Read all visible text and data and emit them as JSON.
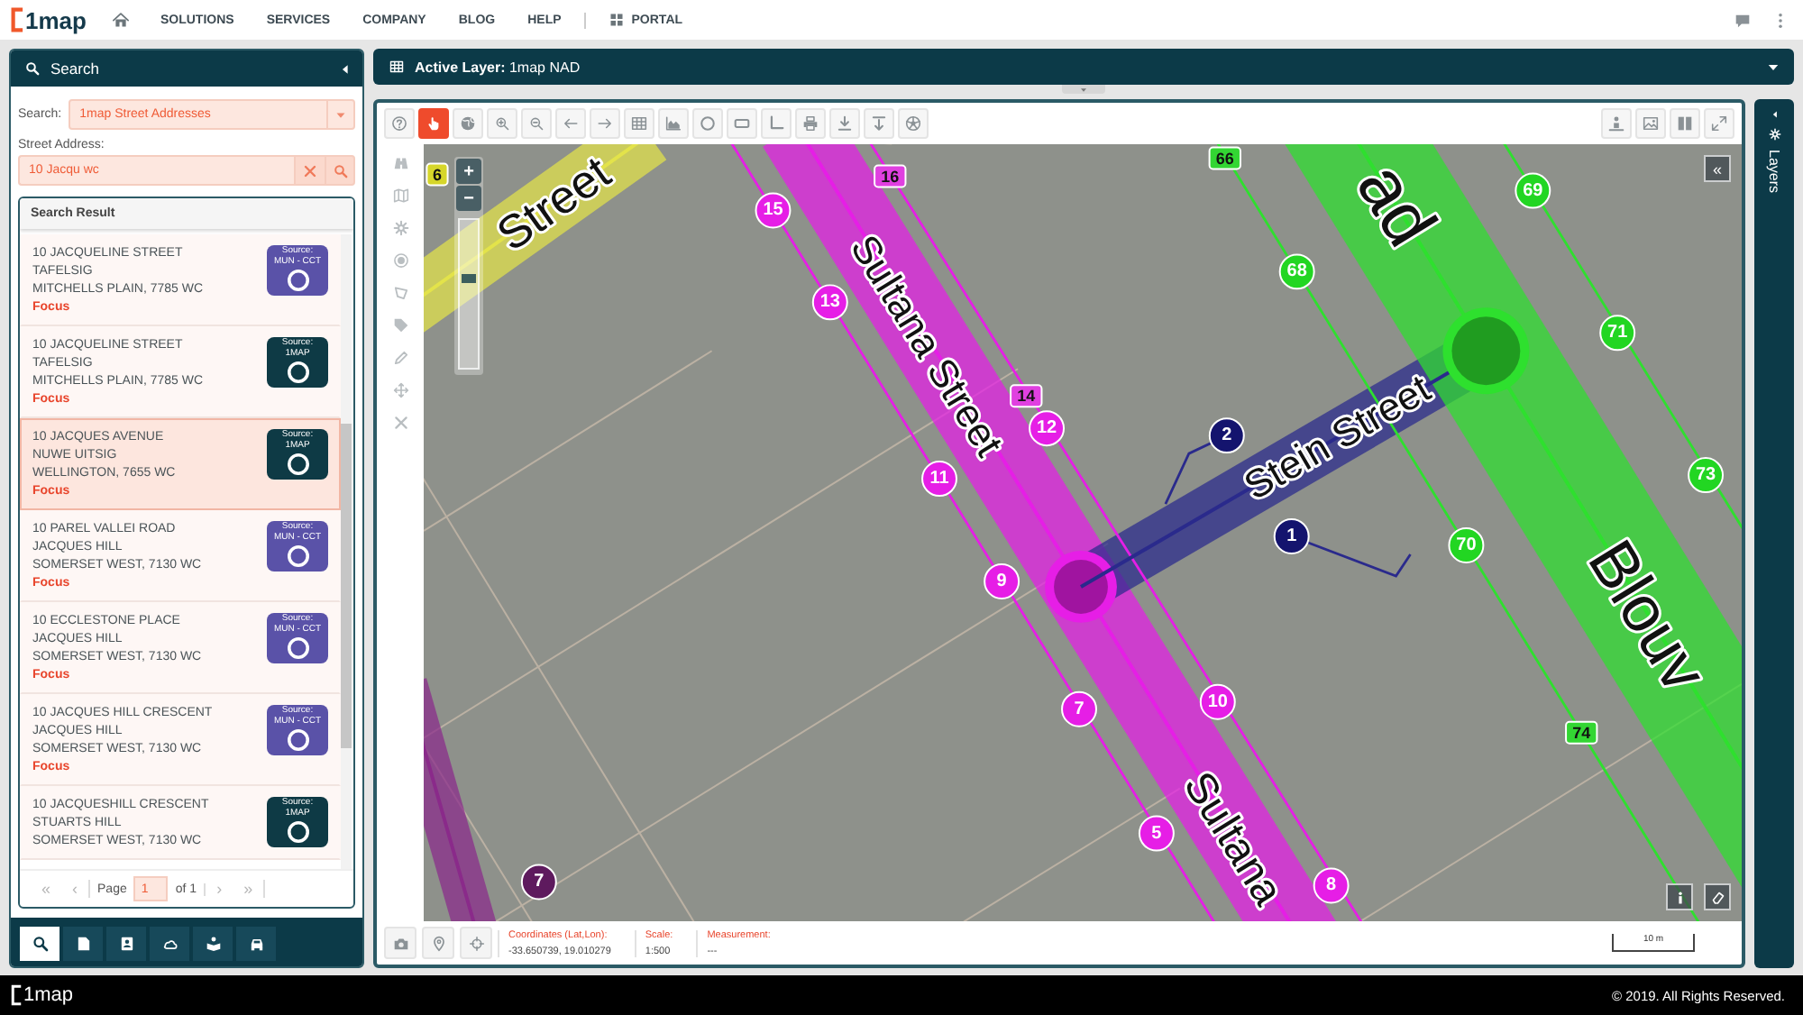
{
  "nav": {
    "logo": "1map",
    "links": [
      "SOLUTIONS",
      "SERVICES",
      "COMPANY",
      "BLOG",
      "HELP"
    ],
    "portal": "PORTAL"
  },
  "search_panel": {
    "title": "Search",
    "search_label": "Search:",
    "search_value": "1map Street Addresses",
    "address_label": "Street Address:",
    "address_value": "10 Jacqu wc",
    "results_title": "Search Result",
    "results": [
      {
        "lines": [
          "10 JACQUELINE STREET",
          "TAFELSIG",
          "MITCHELLS PLAIN, 7785 WC"
        ],
        "focus": "Focus",
        "selected": false,
        "source": {
          "label": "Source:",
          "name": "MUN - CCT",
          "color": "#5a52a8"
        }
      },
      {
        "lines": [
          "10 JACQUELINE STREET",
          "TAFELSIG",
          "MITCHELLS PLAIN, 7785 WC"
        ],
        "focus": "Focus",
        "selected": false,
        "source": {
          "label": "Source:",
          "name": "1MAP",
          "color": "#0e3a45"
        }
      },
      {
        "lines": [
          "10 JACQUES AVENUE",
          "NUWE UITSIG",
          "WELLINGTON, 7655 WC"
        ],
        "focus": "Focus",
        "selected": true,
        "source": {
          "label": "Source:",
          "name": "1MAP",
          "color": "#0e3a45"
        }
      },
      {
        "lines": [
          "10 PAREL VALLEI ROAD",
          "JACQUES HILL",
          "SOMERSET WEST, 7130 WC"
        ],
        "focus": "Focus",
        "selected": false,
        "source": {
          "label": "Source:",
          "name": "MUN - CCT",
          "color": "#5a52a8"
        }
      },
      {
        "lines": [
          "10 ECCLESTONE PLACE",
          "JACQUES HILL",
          "SOMERSET WEST, 7130 WC"
        ],
        "focus": "Focus",
        "selected": false,
        "source": {
          "label": "Source:",
          "name": "MUN - CCT",
          "color": "#5a52a8"
        }
      },
      {
        "lines": [
          "10 JACQUES HILL CRESCENT",
          "JACQUES HILL",
          "SOMERSET WEST, 7130 WC"
        ],
        "focus": "Focus",
        "selected": false,
        "source": {
          "label": "Source:",
          "name": "MUN - CCT",
          "color": "#5a52a8"
        }
      },
      {
        "lines": [
          "10 JACQUESHILL CRESCENT",
          "STUARTS HILL",
          "SOMERSET WEST, 7130 WC"
        ],
        "selected": false,
        "source": {
          "label": "Source:",
          "name": "1MAP",
          "color": "#0e3a45"
        }
      }
    ],
    "pager": {
      "first": "«",
      "prev": "‹",
      "page_label": "Page",
      "page_value": "1",
      "of_label": "of 1",
      "next": "›",
      "last": "»"
    },
    "tabs": [
      {
        "kind": "search",
        "selected": true
      },
      {
        "kind": "document",
        "selected": false
      },
      {
        "kind": "contact",
        "selected": false
      },
      {
        "kind": "cloud",
        "selected": false
      },
      {
        "kind": "reader",
        "selected": false
      },
      {
        "kind": "car",
        "selected": false
      }
    ]
  },
  "main": {
    "active_layer": "**Active Layer:** 1map NAD",
    "tools": [
      {
        "kind": "help",
        "selected": false
      },
      {
        "kind": "pan",
        "selected": true
      },
      {
        "kind": "globe",
        "selected": false
      },
      {
        "kind": "zoom-in",
        "selected": false
      },
      {
        "kind": "zoom-out",
        "selected": false
      },
      {
        "kind": "back",
        "selected": false
      },
      {
        "kind": "forward",
        "selected": false
      },
      {
        "kind": "table",
        "selected": false
      },
      {
        "kind": "chart",
        "selected": false
      },
      {
        "kind": "circle",
        "selected": false
      },
      {
        "kind": "rectangle",
        "selected": false
      },
      {
        "kind": "angle",
        "selected": false
      },
      {
        "kind": "print",
        "selected": false
      },
      {
        "kind": "download",
        "selected": false
      },
      {
        "kind": "download-top",
        "selected": false
      },
      {
        "kind": "ball",
        "selected": false
      }
    ],
    "right_tools": [
      {
        "kind": "person"
      },
      {
        "kind": "image"
      },
      {
        "kind": "columns"
      },
      {
        "kind": "expand"
      }
    ],
    "side_tools": [
      {
        "kind": "binoculars"
      },
      {
        "kind": "map-book"
      },
      {
        "kind": "gear"
      },
      {
        "kind": "target"
      },
      {
        "kind": "polygon"
      },
      {
        "kind": "tag"
      },
      {
        "kind": "pencil"
      },
      {
        "kind": "move"
      },
      {
        "kind": "close"
      }
    ],
    "map": {
      "zoom": {
        "zoom_in": "+",
        "zoom_out": "−",
        "level": 0.62
      },
      "collapse_button": "«",
      "corner_buttons": [
        {
          "kind": "info"
        },
        {
          "kind": "eraser"
        }
      ],
      "streets": [
        {
          "color": "#e3e34a",
          "labels": [
            "Street"
          ]
        },
        {
          "color": "#e61ee6",
          "labels": [
            "Sultana Street",
            "Sultana"
          ]
        },
        {
          "color": "#2a2a8c",
          "labels": [
            "Stein Street"
          ]
        },
        {
          "color": "#2ee02e",
          "labels": [
            "ad",
            "Blouv"
          ]
        },
        {
          "color": "#8a2a8a"
        }
      ],
      "markers": [
        {
          "label": "6",
          "color": "#d6d62a",
          "kind": "tag"
        },
        {
          "label": "16",
          "color": "#e040e0",
          "kind": "tag"
        },
        {
          "label": "66",
          "color": "#33d633",
          "kind": "tag"
        },
        {
          "label": "69",
          "color": "#22d622",
          "kind": "dot"
        },
        {
          "label": "15",
          "color": "#e61ee6",
          "kind": "dot"
        },
        {
          "label": "68",
          "color": "#22d622",
          "kind": "dot"
        },
        {
          "label": "14",
          "color": "#e040e0",
          "kind": "tag"
        },
        {
          "label": "13",
          "color": "#e61ee6",
          "kind": "dot"
        },
        {
          "label": "71",
          "color": "#22d622",
          "kind": "dot"
        },
        {
          "label": "12",
          "color": "#e61ee6",
          "kind": "dot"
        },
        {
          "label": "2",
          "color": "#14146e",
          "kind": "dot"
        },
        {
          "label": "11",
          "color": "#e61ee6",
          "kind": "dot"
        },
        {
          "label": "73",
          "color": "#22d622",
          "kind": "dot"
        },
        {
          "label": "1",
          "color": "#14146e",
          "kind": "dot"
        },
        {
          "label": "70",
          "color": "#22d622",
          "kind": "dot"
        },
        {
          "label": "9",
          "color": "#e61ee6",
          "kind": "dot"
        },
        {
          "label": "10",
          "color": "#e61ee6",
          "kind": "dot"
        },
        {
          "label": "7",
          "color": "#e61ee6",
          "kind": "dot"
        },
        {
          "label": "74",
          "color": "#33d633",
          "kind": "tag"
        },
        {
          "label": "5",
          "color": "#e61ee6",
          "kind": "dot"
        },
        {
          "label": "7",
          "color": "#5e1a5e",
          "kind": "dot"
        },
        {
          "label": "8",
          "color": "#e61ee6",
          "kind": "dot"
        }
      ]
    },
    "status": {
      "buttons": [
        {
          "kind": "camera"
        },
        {
          "kind": "pin"
        },
        {
          "kind": "crosshair"
        }
      ],
      "fields": [
        {
          "label": "Coordinates (Lat,Lon):",
          "value": "-33.650739, 19.010279"
        },
        {
          "label": "Scale:",
          "value": "1:500"
        },
        {
          "label": "Measurement:",
          "value": "---"
        }
      ],
      "scale_bar": "10 m"
    },
    "layers_label": "Layers"
  },
  "footer": {
    "logo": "1map",
    "copyright": "© 2019. All Rights Reserved."
  }
}
